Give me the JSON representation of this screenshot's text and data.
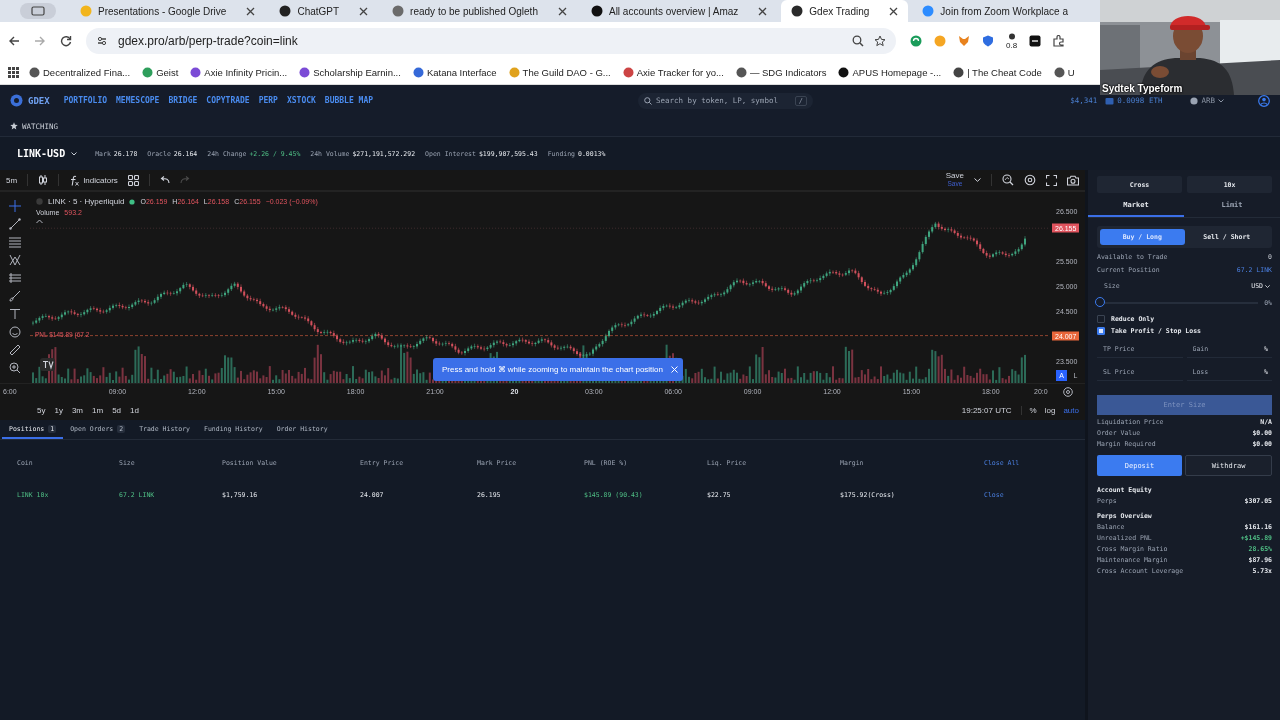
{
  "browser": {
    "tabs": [
      {
        "title": "Presentations - Google Drive",
        "selected": false,
        "cut_off": false
      },
      {
        "title": "ChatGPT",
        "selected": false,
        "cut_off": false
      },
      {
        "title": "ready to be published Ogleth",
        "selected": false,
        "cut_off": false
      },
      {
        "title": "All accounts overview | Amaz",
        "selected": false,
        "cut_off": false
      },
      {
        "title": "Gdex Trading",
        "selected": true,
        "cut_off": false
      },
      {
        "title": "Join from Zoom Workplace a",
        "selected": false,
        "cut_off": true
      }
    ],
    "url": "gdex.pro/arb/perp-trade?coin=link",
    "extension_badge": "0.8",
    "bookmarks": [
      "Decentralized Fina...",
      "Geist",
      "Axie Infinity Pricin...",
      "Scholarship Earnin...",
      "Katana Interface",
      "The Guild DAO - G...",
      "Axie Tracker for yo...",
      "— SDG Indicators",
      "APUS Homepage -...",
      "| The Cheat Code",
      "U"
    ]
  },
  "video_overlay": {
    "label": "Sydtek Typeform"
  },
  "header": {
    "logo": "GDEX",
    "nav": [
      "PORTFOLIO",
      "MEMESCOPE",
      "BRIDGE",
      "COPYTRADE",
      "PERP",
      "XSTOCK",
      "BUBBLE MAP"
    ],
    "search": {
      "placeholder": "Search by token, LP, symbol",
      "shortcut": "/"
    },
    "balance": "$4,341",
    "wallet": "0.0098 ETH",
    "network": "ARB"
  },
  "watchlist": {
    "label": "WATCHING"
  },
  "market": {
    "symbol": "LINK-USD",
    "stats": [
      {
        "label": "Mark",
        "value": "26.178",
        "positive": false
      },
      {
        "label": "Oracle",
        "value": "26.164",
        "positive": false
      },
      {
        "label": "24h Change",
        "value": "+2.26 / 9.45%",
        "positive": true
      },
      {
        "label": "24h Volume",
        "value": "$271,191,572.292",
        "positive": false
      },
      {
        "label": "Open Interest",
        "value": "$199,907,595.43",
        "positive": false
      },
      {
        "label": "Funding",
        "value": "0.0013%",
        "positive": false
      }
    ]
  },
  "chart": {
    "interval": "5m",
    "indicators": "Indicators",
    "save": "Save",
    "save_note": "Save",
    "legend": {
      "title": "LINK · 5 · Hyperliquid",
      "ohlc": [
        {
          "key": "O",
          "value": "26.159"
        },
        {
          "key": "H",
          "value": "26.164"
        },
        {
          "key": "L",
          "value": "26.158"
        },
        {
          "key": "C",
          "value": "26.155"
        }
      ],
      "change": "−0.023 (−0.09%)",
      "volume_label": "Volume",
      "volume": "593.2"
    },
    "pnl_label": "PNL $145.89 (67.2",
    "price_ticks": [
      "26.500",
      "25.500",
      "25.000",
      "24.500",
      "23.500"
    ],
    "last_price": "26.155",
    "entry_price": "24.007",
    "time_ticks": [
      {
        "label": "6:00",
        "bold": false
      },
      {
        "label": "09:00",
        "bold": false
      },
      {
        "label": "12:00",
        "bold": false
      },
      {
        "label": "15:00",
        "bold": false
      },
      {
        "label": "18:00",
        "bold": false
      },
      {
        "label": "21:00",
        "bold": false
      },
      {
        "label": "20",
        "bold": true
      },
      {
        "label": "03:00",
        "bold": false
      },
      {
        "label": "06:00",
        "bold": false
      },
      {
        "label": "09:00",
        "bold": false
      },
      {
        "label": "12:00",
        "bold": false
      },
      {
        "label": "15:00",
        "bold": false
      },
      {
        "label": "18:00",
        "bold": false
      },
      {
        "label": "20:0",
        "bold": false
      }
    ],
    "scale_buttons": [
      {
        "label": "A",
        "selected": true
      },
      {
        "label": "L",
        "selected": false
      }
    ],
    "toast": "Press and hold ⌘ while zooming to maintain the chart position",
    "ranges": [
      "5y",
      "1y",
      "3m",
      "1m",
      "5d",
      "1d"
    ],
    "clock": "19:25:07 UTC",
    "axis_options": [
      {
        "label": "%",
        "selected": false
      },
      {
        "label": "log",
        "selected": false
      },
      {
        "label": "auto",
        "selected": true
      }
    ]
  },
  "positions": {
    "tabs": [
      {
        "label": "Positions",
        "count": "1",
        "selected": true
      },
      {
        "label": "Open Orders",
        "count": "2",
        "selected": false
      },
      {
        "label": "Trade History",
        "selected": false
      },
      {
        "label": "Funding History",
        "selected": false
      },
      {
        "label": "Order History",
        "selected": false
      }
    ],
    "columns": [
      "Coin",
      "Size",
      "Position Value",
      "Entry Price",
      "Mark Price",
      "PNL (ROE %)",
      "Liq. Price",
      "Margin"
    ],
    "close_all": "Close All",
    "rows": [
      {
        "cells": [
          {
            "text": "LINK 10x",
            "positive": true
          },
          {
            "text": "67.2 LINK",
            "positive": true
          },
          {
            "text": "$1,759.16",
            "positive": false
          },
          {
            "text": "24.007",
            "positive": false
          },
          {
            "text": "26.195",
            "positive": false
          },
          {
            "text": "$145.89 (90.43)",
            "positive": true
          },
          {
            "text": "$22.75",
            "positive": false
          },
          {
            "text": "$175.92(Cross)",
            "positive": false
          }
        ],
        "action": "Close"
      }
    ]
  },
  "order_panel": {
    "margin_mode": "Cross",
    "leverage": "10x",
    "order_types": [
      {
        "label": "Market",
        "selected": true
      },
      {
        "label": "Limit",
        "selected": false
      }
    ],
    "sides": [
      {
        "label": "Buy / Long",
        "selected": true
      },
      {
        "label": "Sell / Short",
        "selected": false
      }
    ],
    "info": [
      {
        "label": "Available to Trade",
        "value": "0",
        "highlight": false
      },
      {
        "label": "Current Position",
        "value": "67.2 LINK",
        "highlight": true
      }
    ],
    "size_field": {
      "placeholder": "Size",
      "unit": "USD"
    },
    "slider": {
      "level": 0,
      "reading": "0%"
    },
    "options": [
      {
        "label": "Reduce Only",
        "checked": false
      },
      {
        "label": "Take Profit / Stop Loss",
        "checked": true
      }
    ],
    "tpsl": [
      {
        "price_placeholder": "TP Price",
        "pct_placeholder": "Gain",
        "unit": "%"
      },
      {
        "price_placeholder": "SL Price",
        "pct_placeholder": "Loss",
        "unit": "%"
      }
    ],
    "submit": {
      "label": "Enter Size",
      "disabled": true
    },
    "summary": [
      {
        "label": "Liquidation Price",
        "value": "N/A"
      },
      {
        "label": "Order Value",
        "value": "$0.00"
      },
      {
        "label": "Margin Required",
        "value": "$0.00"
      }
    ],
    "actions": [
      {
        "label": "Deposit",
        "kind": "primary"
      },
      {
        "label": "Withdraw",
        "kind": "outline"
      }
    ],
    "account": [
      {
        "kind": "heading",
        "label": "Account Equity"
      },
      {
        "kind": "row",
        "label": "Perps",
        "value": "$307.05",
        "positive": false
      },
      {
        "kind": "heading",
        "label": "Perps Overview"
      },
      {
        "kind": "row",
        "label": "Balance",
        "value": "$161.16",
        "positive": false
      },
      {
        "kind": "row",
        "label": "Unrealized PNL",
        "value": "+$145.89",
        "positive": true
      },
      {
        "kind": "row",
        "label": "Cross Margin Ratio",
        "value": "28.65%",
        "positive": true
      },
      {
        "kind": "row",
        "label": "Maintenance Margin",
        "value": "$87.96",
        "positive": false
      },
      {
        "kind": "row",
        "label": "Cross Account Leverage",
        "value": "5.73x",
        "positive": false
      }
    ]
  }
}
